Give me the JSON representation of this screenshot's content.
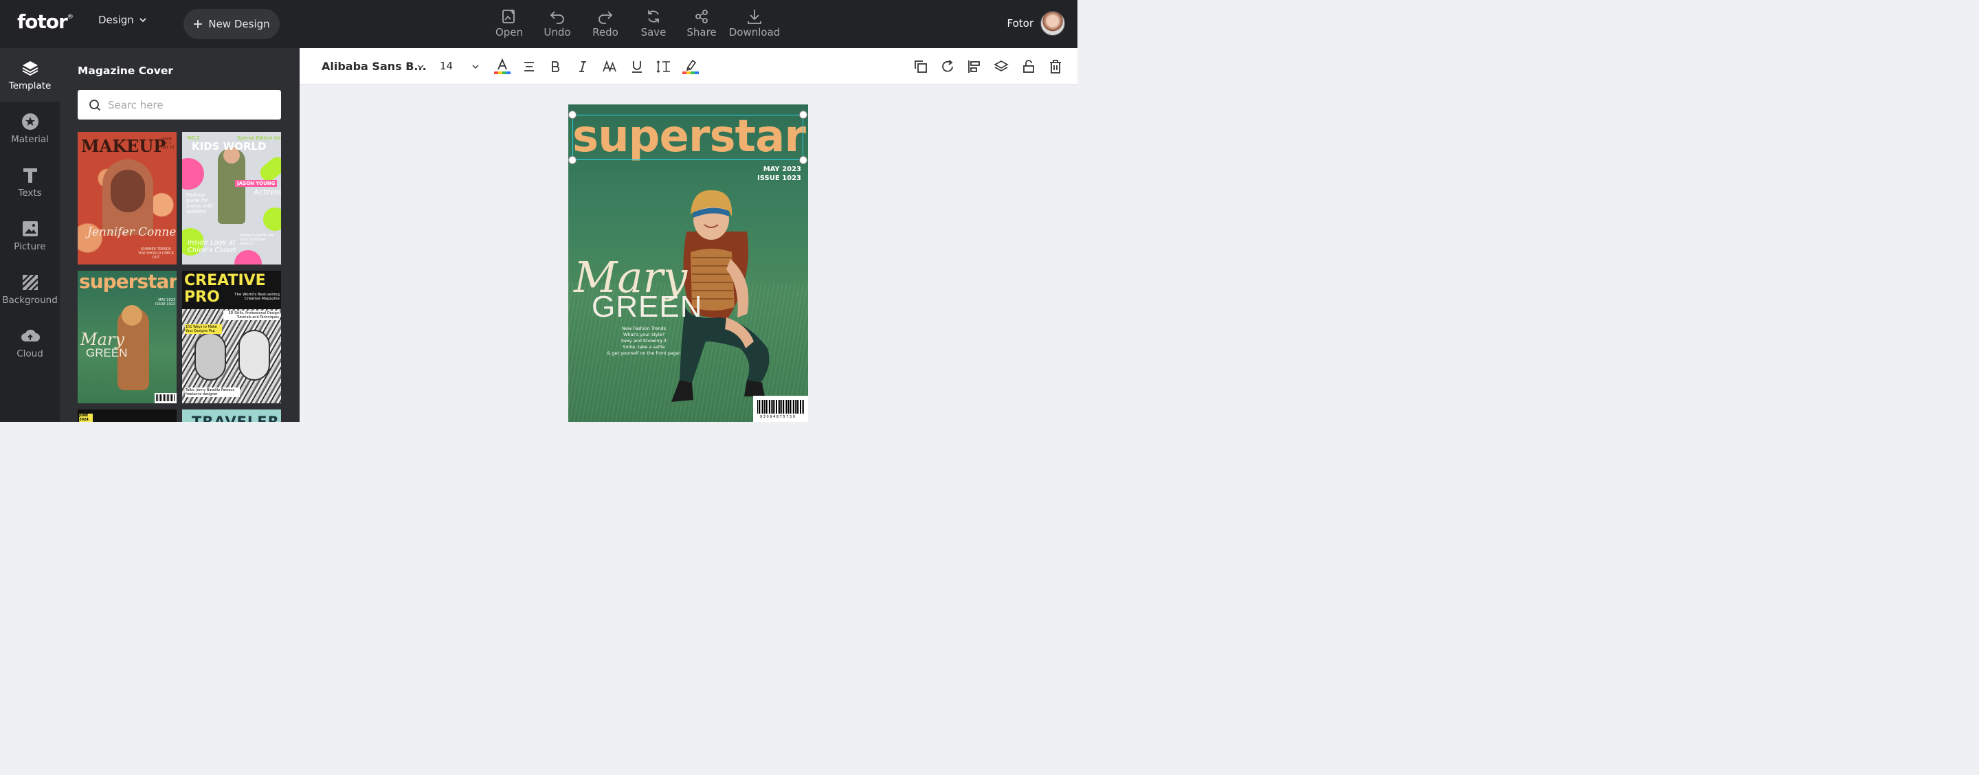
{
  "app": {
    "logo": "fotor",
    "logo_mark": "®",
    "design_menu": "Design",
    "new_design": "New Design",
    "user_name": "Fotor"
  },
  "toolbar": {
    "open": "Open",
    "undo": "Undo",
    "redo": "Redo",
    "save": "Save",
    "share": "Share",
    "download": "Download"
  },
  "rail": {
    "template": "Template",
    "material": "Material",
    "texts": "Texts",
    "picture": "Picture",
    "background": "Background",
    "cloud": "Cloud"
  },
  "panel": {
    "title": "Magazine Cover",
    "search_placeholder": "Searc here",
    "templates": [
      {
        "title": "MAKEUP",
        "issue": "ISSUE NO. 1 JULY 23",
        "name": "Jennifer Conner",
        "note": "SUMMER TRENDS YOU SHOULD CHECK OUT"
      },
      {
        "title": "KIDS WORLD",
        "tag": "Special Edition Issue",
        "no": "NO.2",
        "name": "JASON YOUNG",
        "role": "Actress",
        "caption": "Inside Look at Chloe's Closet",
        "note": "Hottest outfits for the Christmas Season",
        "side": "Fashion guide for moms with toddlers"
      },
      {
        "title": "superstar",
        "issue": "MAY 2023 ISSUE 1023",
        "name1": "Mary",
        "name2": "GREEN"
      },
      {
        "title1": "CREATIVE",
        "title2": "PRO",
        "tag": "The World's Best-selling Creative Magazine",
        "skills": "3D Skills, Professional Design Tutorials and Techniques",
        "ways": "101 Ways to Make Your Designs Pop",
        "talks": "Talks: Jenny Baselitz Famous freelance designer"
      },
      {
        "title": "JUNE 2024"
      },
      {
        "title": "TRAVELER"
      }
    ]
  },
  "format": {
    "font": "Alibaba Sans B...",
    "size": "14"
  },
  "cover": {
    "title": "superstar",
    "issue_date": "MAY 2023",
    "issue_no": "ISSUE 1023",
    "name1": "Mary",
    "name2": "GREEN",
    "trends": [
      "New Fashion Trends",
      "What's your style?",
      "Sexy and Knowing it",
      "Smile, take a selfie",
      "& get yourself on the front page!"
    ],
    "barcode": "9 3 0 9 4 8 7 5 7 3 9"
  },
  "colors": {
    "topbar": "#222326",
    "panel": "#2e2f33",
    "accent_title": "#f0b070",
    "selection": "#2ad0e6"
  }
}
